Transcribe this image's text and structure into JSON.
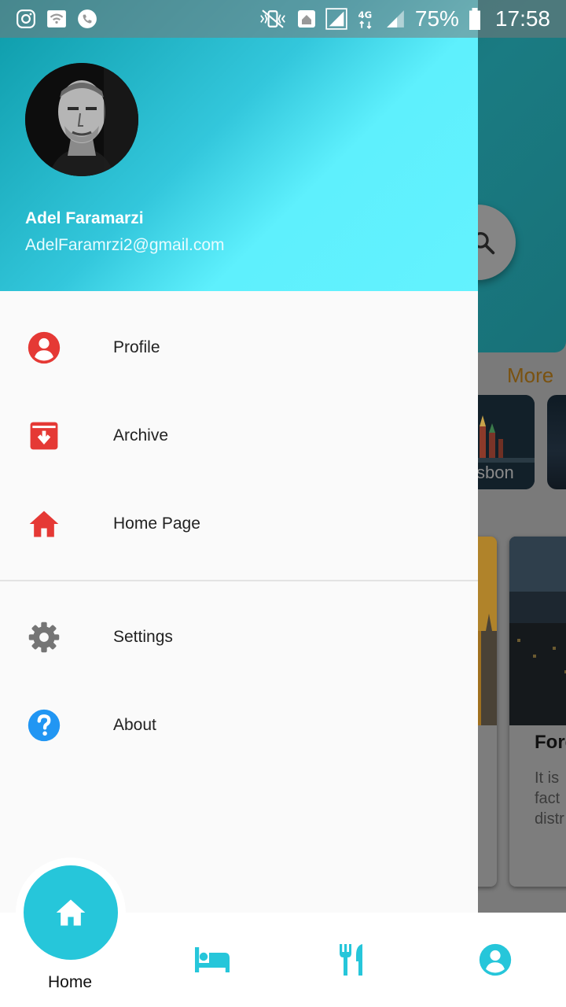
{
  "status_bar": {
    "battery_percent": "75%",
    "time": "17:58",
    "network": "4G"
  },
  "background": {
    "more_label": "More",
    "city_label": "sbon",
    "card_title": "Fore",
    "card_text": "It is fact distr"
  },
  "drawer": {
    "user": {
      "name": "Adel Faramarzi",
      "email": "AdelFaramrzi2@gmail.com"
    },
    "menu_primary": [
      {
        "label": "Profile",
        "icon": "account-circle-icon",
        "color": "#e53935"
      },
      {
        "label": "Archive",
        "icon": "archive-icon",
        "color": "#e53935"
      },
      {
        "label": "Home Page",
        "icon": "home-icon",
        "color": "#e53935"
      }
    ],
    "menu_secondary": [
      {
        "label": "Settings",
        "icon": "gear-icon",
        "color": "#757575"
      },
      {
        "label": "About",
        "icon": "help-icon",
        "color": "#2196f3"
      }
    ]
  },
  "bottom_nav": {
    "accent": "#26c6da",
    "items": [
      {
        "label": "Home",
        "icon": "home-icon",
        "active": true
      },
      {
        "label": "",
        "icon": "bed-icon"
      },
      {
        "label": "",
        "icon": "restaurant-icon"
      },
      {
        "label": "",
        "icon": "account-circle-icon"
      }
    ]
  }
}
